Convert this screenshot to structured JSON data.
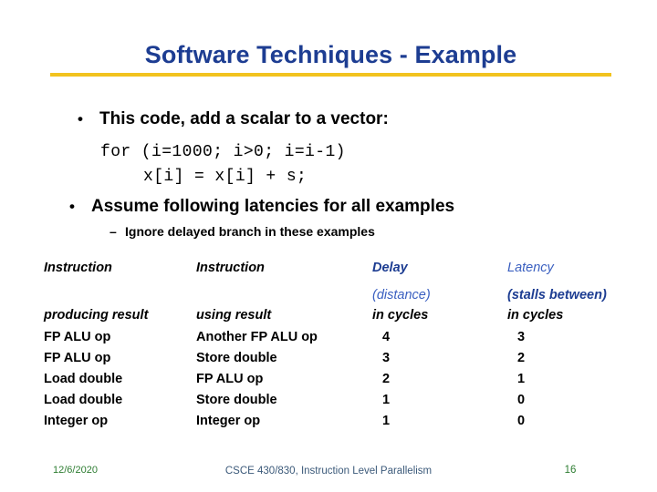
{
  "slide": {
    "title": "Software Techniques - Example",
    "accent_title_color": "#1d3d92",
    "accent_rule_color": "#f2c31e"
  },
  "bullets": {
    "bullet_char": "•",
    "dash_char": "–",
    "item1": "This code, add a scalar to a vector:",
    "item2": "Assume following latencies for all examples",
    "sub1": "Ignore delayed branch in these examples"
  },
  "code": {
    "line1": "for (i=1000; i>0; i=i-1)",
    "line2": "x[i] = x[i] + s;"
  },
  "table": {
    "headers": {
      "col1_line1": "Instruction",
      "col1_line3": "producing result",
      "col2_line1": "Instruction",
      "col2_line3": "using result",
      "col3_line1": "Delay",
      "col3_line2": "(distance)",
      "col3_line3": "in cycles",
      "col4_line1": "Latency",
      "col4_line2": "(stalls between)",
      "col4_line3": "in cycles"
    },
    "rows": [
      {
        "producing": "FP ALU op",
        "using": "Another FP ALU op",
        "delay": "4",
        "latency": "3"
      },
      {
        "producing": "FP ALU op",
        "using": "Store double",
        "delay": "3",
        "latency": "2"
      },
      {
        "producing": "Load double",
        "using": "FP ALU op",
        "delay": "2",
        "latency": "1"
      },
      {
        "producing": "Load double",
        "using": "Store double",
        "delay": "1",
        "latency": "0"
      },
      {
        "producing": "Integer op",
        "using": "Integer op",
        "delay": "1",
        "latency": "0"
      }
    ]
  },
  "footer": {
    "date": "12/6/2020",
    "center": "CSCE 430/830, Instruction Level Parallelism",
    "page": "16"
  }
}
